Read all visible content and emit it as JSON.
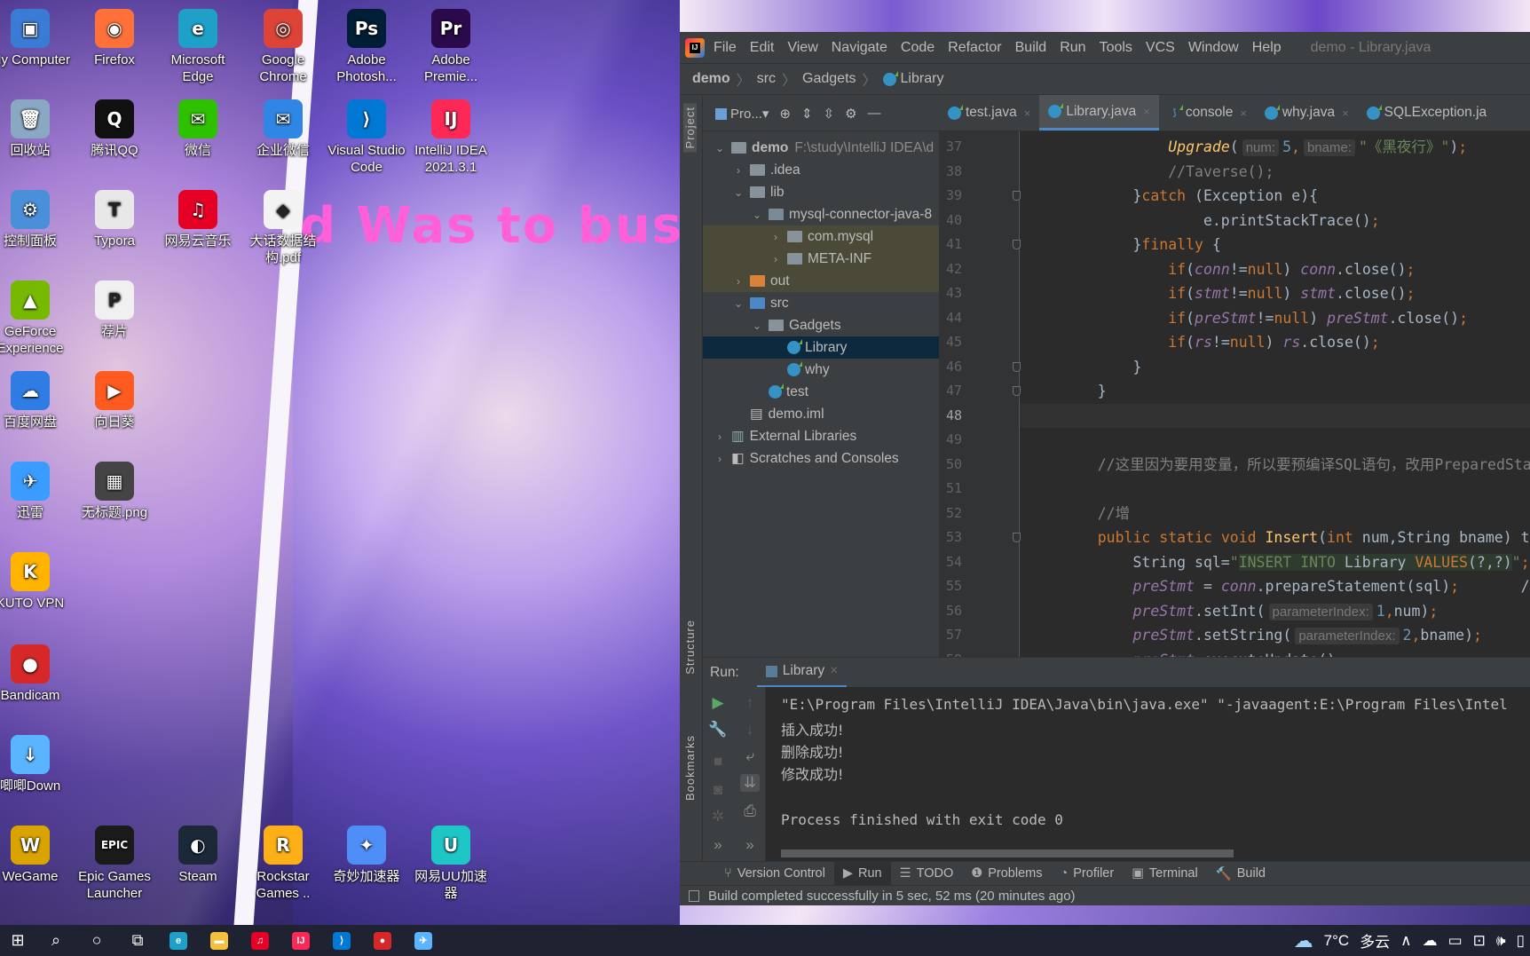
{
  "wallpaper": {
    "text": "d Was to busy"
  },
  "desktop_icons": [
    {
      "label": "My Computer",
      "glyph": "▣",
      "color": "#3a7bd5"
    },
    {
      "label": "Firefox",
      "glyph": "◉",
      "color": "#ff7139"
    },
    {
      "label": "Microsoft Edge",
      "glyph": "e",
      "color": "#1fa0c8"
    },
    {
      "label": "Google Chrome",
      "glyph": "◎",
      "color": "#db4437"
    },
    {
      "label": "Adobe Photosh...",
      "glyph": "Ps",
      "color": "#001e36"
    },
    {
      "label": "Adobe Premie...",
      "glyph": "Pr",
      "color": "#2a0a4a"
    },
    {
      "label": "回收站",
      "glyph": "🗑",
      "color": "#8aa7c4"
    },
    {
      "label": "腾讯QQ",
      "glyph": "Q",
      "color": "#111111"
    },
    {
      "label": "微信",
      "glyph": "✉",
      "color": "#2dc100"
    },
    {
      "label": "企业微信",
      "glyph": "✉",
      "color": "#2f86e4"
    },
    {
      "label": "Visual Studio Code",
      "glyph": "⟩",
      "color": "#0078d4"
    },
    {
      "label": "IntelliJ IDEA 2021.3.1",
      "glyph": "IJ",
      "color": "#fe2857"
    },
    {
      "label": "控制面板",
      "glyph": "⚙",
      "color": "#4a90d9"
    },
    {
      "label": "Typora",
      "glyph": "T",
      "color": "#e8e8e8"
    },
    {
      "label": "网易云音乐",
      "glyph": "♫",
      "color": "#e60026"
    },
    {
      "label": "大话数据结构.pdf",
      "glyph": "◆",
      "color": "#f3f3f3"
    },
    {
      "label": "GeForce Experience",
      "glyph": "▲",
      "color": "#76b900"
    },
    {
      "label": "荐片",
      "glyph": "P",
      "color": "#f0f0f0"
    },
    {
      "label": "百度网盘",
      "glyph": "☁",
      "color": "#2f7ce5"
    },
    {
      "label": "向日葵",
      "glyph": "▶",
      "color": "#ff5a1f"
    },
    {
      "label": "迅雷",
      "glyph": "✈",
      "color": "#3b9cff"
    },
    {
      "label": "无标题.png",
      "glyph": "▦",
      "color": "#444444"
    },
    {
      "label": "KUTO VPN",
      "glyph": "K",
      "color": "#ffb400"
    },
    {
      "label": "Bandicam",
      "glyph": "●",
      "color": "#d62828"
    },
    {
      "label": "唧唧Down",
      "glyph": "↓",
      "color": "#5ab4ff"
    },
    {
      "label": "WeGame",
      "glyph": "W",
      "color": "#d9a400"
    },
    {
      "label": "Epic Games Launcher",
      "glyph": "EPIC",
      "color": "#1b1b1b"
    },
    {
      "label": "Steam",
      "glyph": "◐",
      "color": "#1b2838"
    },
    {
      "label": "Rockstar Games ..",
      "glyph": "R",
      "color": "#fcaf17"
    },
    {
      "label": "奇妙加速器",
      "glyph": "✦",
      "color": "#4f8ef7"
    },
    {
      "label": "网易UU加速器",
      "glyph": "U",
      "color": "#1ec6c6"
    }
  ],
  "ide": {
    "menu": [
      "File",
      "Edit",
      "View",
      "Navigate",
      "Code",
      "Refactor",
      "Build",
      "Run",
      "Tools",
      "VCS",
      "Window",
      "Help"
    ],
    "window_title": "demo - Library.java",
    "breadcrumb": [
      "demo",
      "src",
      "Gadgets",
      "Library"
    ],
    "side_labels": {
      "project": "Project",
      "structure": "Structure",
      "bookmarks": "Bookmarks"
    },
    "project_view_label": "Pro...▾",
    "tree": [
      {
        "label": "demo",
        "extra": "F:\\study\\IntelliJ IDEA\\d",
        "arrow": "⌄",
        "type": "module"
      },
      {
        "label": ".idea",
        "arrow": "›",
        "type": "folder"
      },
      {
        "label": "lib",
        "arrow": "⌄",
        "type": "folder"
      },
      {
        "label": "mysql-connector-java-8",
        "arrow": "⌄",
        "type": "jar"
      },
      {
        "label": "com.mysql",
        "arrow": "›",
        "type": "folder"
      },
      {
        "label": "META-INF",
        "arrow": "›",
        "type": "folder"
      },
      {
        "label": "out",
        "arrow": "›",
        "type": "folder-orange"
      },
      {
        "label": "src",
        "arrow": "⌄",
        "type": "folder-blue"
      },
      {
        "label": "Gadgets",
        "arrow": "⌄",
        "type": "package"
      },
      {
        "label": "Library",
        "arrow": "",
        "type": "class"
      },
      {
        "label": "why",
        "arrow": "",
        "type": "class"
      },
      {
        "label": "test",
        "arrow": "",
        "type": "class"
      },
      {
        "label": "demo.iml",
        "arrow": "",
        "type": "iml"
      },
      {
        "label": "External Libraries",
        "arrow": "›",
        "type": "libs"
      },
      {
        "label": "Scratches and Consoles",
        "arrow": "›",
        "type": "scratch"
      }
    ],
    "selected_tree_item": "Library",
    "tabs": [
      {
        "label": "test.java",
        "active": false
      },
      {
        "label": "Library.java",
        "active": true
      },
      {
        "label": "console",
        "active": false
      },
      {
        "label": "why.java",
        "active": false
      },
      {
        "label": "SQLException.ja",
        "active": false
      }
    ],
    "current_line": 48,
    "code_lines": [
      {
        "n": 37,
        "segs": [
          [
            "",
            "            "
          ],
          [
            "it fn",
            "Upgrade"
          ],
          [
            "",
            "("
          ],
          [
            "hint",
            "num:"
          ],
          [
            "nm",
            "5"
          ],
          [
            "kw",
            ","
          ],
          [
            "hint",
            "bname:"
          ],
          [
            "st",
            "\"《黑夜行》\""
          ],
          [
            "",
            ")"
          ],
          [
            "kw",
            ";"
          ]
        ]
      },
      {
        "n": 38,
        "segs": [
          [
            "",
            "            "
          ],
          [
            "cm",
            "//Taverse();"
          ]
        ]
      },
      {
        "n": 39,
        "segs": [
          [
            "",
            "        }"
          ],
          [
            "kw",
            "catch"
          ],
          [
            "",
            " (Exception e){"
          ]
        ]
      },
      {
        "n": 40,
        "segs": [
          [
            "",
            "                e.printStackTrace()"
          ],
          [
            "kw",
            ";"
          ]
        ]
      },
      {
        "n": 41,
        "segs": [
          [
            "",
            "        }"
          ],
          [
            "kw",
            "finally"
          ],
          [
            "",
            " {"
          ]
        ]
      },
      {
        "n": 42,
        "segs": [
          [
            "",
            "            "
          ],
          [
            "kw",
            "if"
          ],
          [
            "",
            "("
          ],
          [
            "fd",
            "conn"
          ],
          [
            "",
            "!="
          ],
          [
            "kw",
            "null"
          ],
          [
            "",
            ") "
          ],
          [
            "fd",
            "conn"
          ],
          [
            "",
            ".close()"
          ],
          [
            "kw",
            ";"
          ]
        ]
      },
      {
        "n": 43,
        "segs": [
          [
            "",
            "            "
          ],
          [
            "kw",
            "if"
          ],
          [
            "",
            "("
          ],
          [
            "fd",
            "stmt"
          ],
          [
            "",
            "!="
          ],
          [
            "kw",
            "null"
          ],
          [
            "",
            ") "
          ],
          [
            "fd",
            "stmt"
          ],
          [
            "",
            ".close()"
          ],
          [
            "kw",
            ";"
          ]
        ]
      },
      {
        "n": 44,
        "segs": [
          [
            "",
            "            "
          ],
          [
            "kw",
            "if"
          ],
          [
            "",
            "("
          ],
          [
            "fd",
            "preStmt"
          ],
          [
            "",
            "!="
          ],
          [
            "kw",
            "null"
          ],
          [
            "",
            ") "
          ],
          [
            "fd",
            "preStmt"
          ],
          [
            "",
            ".close()"
          ],
          [
            "kw",
            ";"
          ]
        ]
      },
      {
        "n": 45,
        "segs": [
          [
            "",
            "            "
          ],
          [
            "kw",
            "if"
          ],
          [
            "",
            "("
          ],
          [
            "fd",
            "rs"
          ],
          [
            "",
            "!="
          ],
          [
            "kw",
            "null"
          ],
          [
            "",
            ") "
          ],
          [
            "fd",
            "rs"
          ],
          [
            "",
            ".close()"
          ],
          [
            "kw",
            ";"
          ]
        ]
      },
      {
        "n": 46,
        "segs": [
          [
            "",
            "        }"
          ]
        ]
      },
      {
        "n": 47,
        "segs": [
          [
            "",
            "    }"
          ]
        ]
      },
      {
        "n": 48,
        "segs": []
      },
      {
        "n": 49,
        "segs": []
      },
      {
        "n": 50,
        "segs": [
          [
            "",
            "    "
          ],
          [
            "cm",
            "//这里因为要用变量，所以要预编译SQL语句，改用PreparedStat"
          ]
        ]
      },
      {
        "n": 51,
        "segs": []
      },
      {
        "n": 52,
        "segs": [
          [
            "",
            "    "
          ],
          [
            "cm",
            "//增"
          ]
        ]
      },
      {
        "n": 53,
        "segs": [
          [
            "",
            "    "
          ],
          [
            "kw",
            "public static void "
          ],
          [
            "fn",
            "Insert"
          ],
          [
            "",
            "("
          ],
          [
            "kw",
            "int"
          ],
          [
            "",
            " num,String bname) t"
          ]
        ]
      },
      {
        "n": 54,
        "segs": [
          [
            "",
            "        String sql="
          ],
          [
            "st",
            "\""
          ],
          [
            "st sqlbg kw",
            "INSERT INTO"
          ],
          [
            "sqlbg",
            " Library "
          ],
          [
            "sqlbg kw",
            "VALUES"
          ],
          [
            "sqlbg",
            "(?,?)"
          ],
          [
            "st",
            "\""
          ],
          [
            "kw",
            ";"
          ]
        ]
      },
      {
        "n": 55,
        "segs": [
          [
            "",
            "        "
          ],
          [
            "fd",
            "preStmt"
          ],
          [
            "",
            " = "
          ],
          [
            "fd",
            "conn"
          ],
          [
            "",
            ".prepareStatement(sql)"
          ],
          [
            "kw",
            ";"
          ],
          [
            "",
            "       /"
          ]
        ]
      },
      {
        "n": 56,
        "segs": [
          [
            "",
            "        "
          ],
          [
            "fd",
            "preStmt"
          ],
          [
            "",
            ".setInt("
          ],
          [
            "hint",
            "parameterIndex:"
          ],
          [
            "nm",
            "1"
          ],
          [
            "kw",
            ","
          ],
          [
            "",
            "num)"
          ],
          [
            "kw",
            ";"
          ]
        ]
      },
      {
        "n": 57,
        "segs": [
          [
            "",
            "        "
          ],
          [
            "fd",
            "preStmt"
          ],
          [
            "",
            ".setString("
          ],
          [
            "hint",
            "parameterIndex:"
          ],
          [
            "nm",
            "2"
          ],
          [
            "kw",
            ","
          ],
          [
            "",
            "bname)"
          ],
          [
            "kw",
            ";"
          ]
        ]
      },
      {
        "n": 58,
        "segs": [
          [
            "",
            "        "
          ],
          [
            "fd",
            "preStmt"
          ],
          [
            "",
            ".executeUpdate()"
          ],
          [
            "kw",
            ";"
          ]
        ]
      }
    ],
    "run": {
      "label": "Run:",
      "tab": "Library",
      "output": [
        "\"E:\\Program Files\\IntelliJ IDEA\\Java\\bin\\java.exe\" \"-javaagent:E:\\Program Files\\Intel",
        "插入成功!",
        "删除成功!",
        "修改成功!",
        "",
        "Process finished with exit code 0"
      ]
    },
    "tool_tabs": [
      {
        "label": "Version Control",
        "glyph": "⑂"
      },
      {
        "label": "Run",
        "glyph": "▶",
        "active": true
      },
      {
        "label": "TODO",
        "glyph": "☰"
      },
      {
        "label": "Problems",
        "glyph": "❶"
      },
      {
        "label": "Profiler",
        "glyph": "◔"
      },
      {
        "label": "Terminal",
        "glyph": "▣"
      },
      {
        "label": "Build",
        "glyph": "🔨"
      }
    ],
    "status": "Build completed successfully in 5 sec, 52 ms (20 minutes ago)"
  },
  "taskbar": {
    "apps": [
      {
        "name": "search",
        "glyph": "⌕",
        "color": ""
      },
      {
        "name": "cortana",
        "glyph": "○",
        "color": ""
      },
      {
        "name": "task-view",
        "glyph": "⧉",
        "color": ""
      },
      {
        "name": "edge",
        "glyph": "e",
        "color": "#1fa0c8"
      },
      {
        "name": "file-explorer",
        "glyph": "▬",
        "color": "#f3c13a"
      },
      {
        "name": "netease-music",
        "glyph": "♫",
        "color": "#e60026"
      },
      {
        "name": "intellij",
        "glyph": "IJ",
        "color": "#fe2857"
      },
      {
        "name": "vscode",
        "glyph": "⟩",
        "color": "#0078d4"
      },
      {
        "name": "bandicam",
        "glyph": "●",
        "color": "#d62828"
      },
      {
        "name": "other-app",
        "glyph": "✈",
        "color": "#5ab4ff"
      }
    ],
    "weather": {
      "temp": "7°C",
      "condition": "多云"
    }
  }
}
